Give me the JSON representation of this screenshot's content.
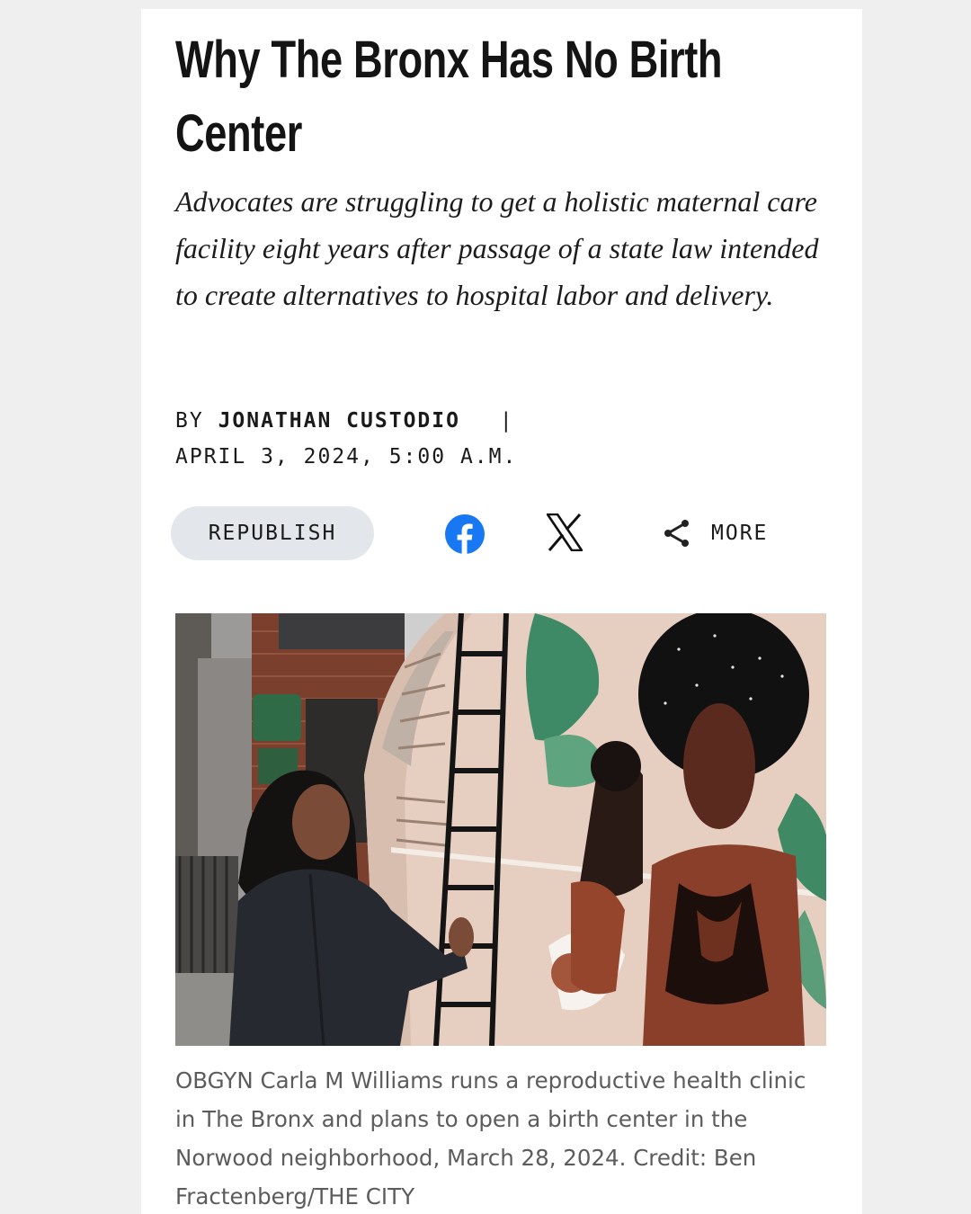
{
  "article": {
    "headline": "Why The Bronx Has No Birth Center",
    "dek": "Advocates are struggling to get a holistic maternal care facility eight years after passage of a state law intended to create alternatives to hospital labor and delivery.",
    "byline_prefix": "BY",
    "author": "JONATHAN CUSTODIO",
    "separator": "|",
    "dateline": "APRIL 3, 2024, 5:00 A.M."
  },
  "actions": {
    "republish_label": "REPUBLISH",
    "facebook_icon": "facebook-icon",
    "x_icon": "x-icon",
    "more_icon": "share-icon",
    "more_label": "MORE"
  },
  "photo": {
    "caption": "OBGYN Carla M Williams runs a reproductive health clinic in The Bronx and plans to open a birth center in the Norwood neighborhood, March 28, 2024. Credit: Ben Fractenberg/THE CITY"
  },
  "colors": {
    "background": "#efefef",
    "card": "#ffffff",
    "facebook": "#1877f2",
    "republish_bg": "#e3e7ec"
  }
}
